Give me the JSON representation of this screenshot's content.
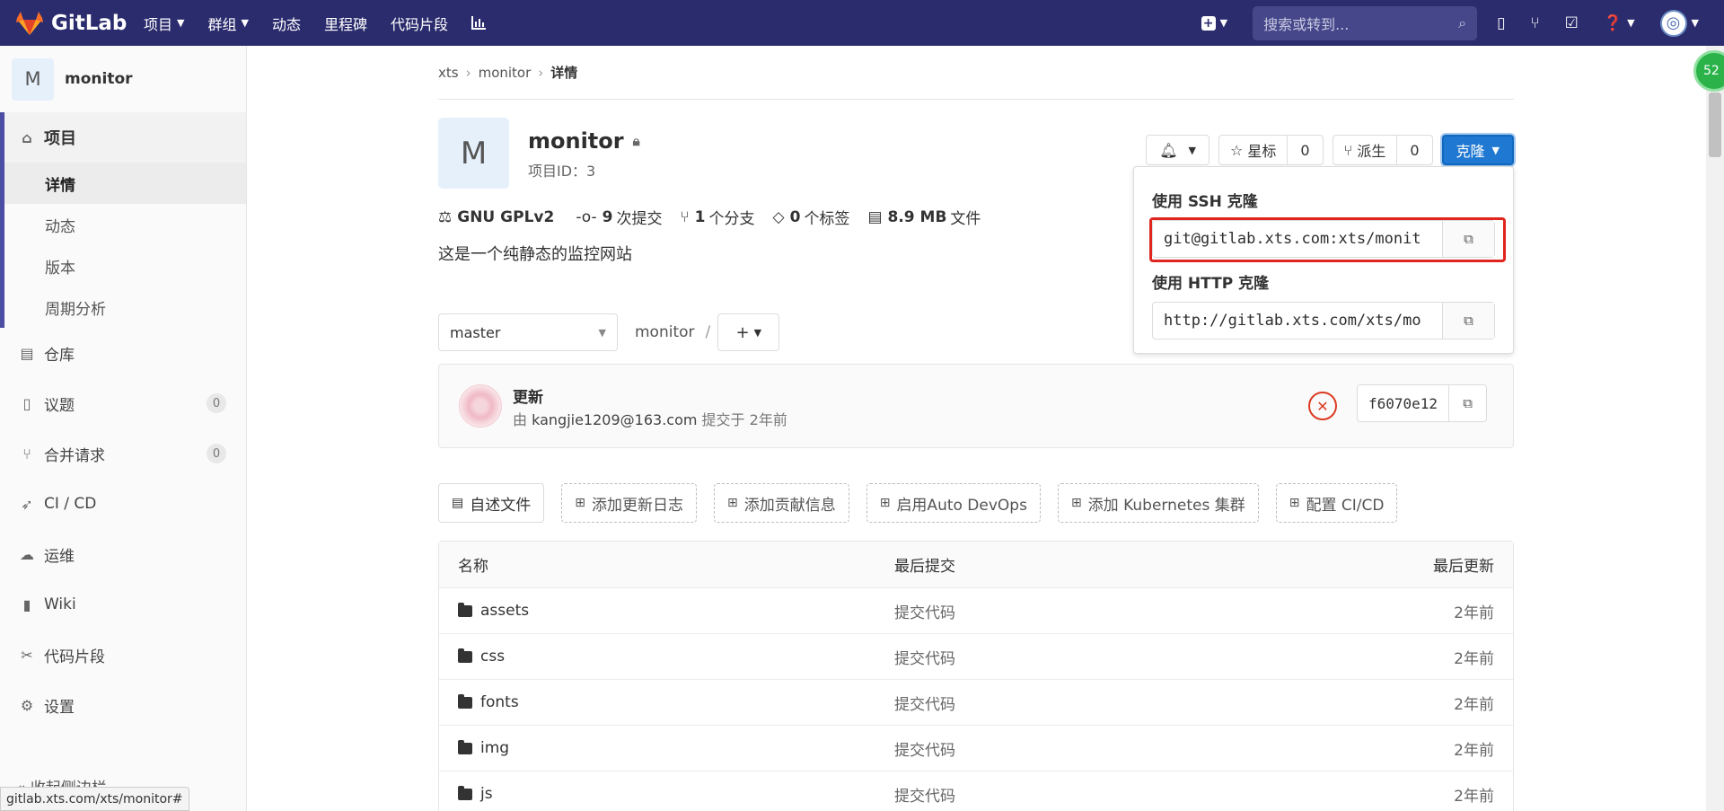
{
  "navbar": {
    "logo": "GitLab",
    "items": [
      "项目",
      "群组",
      "动态",
      "里程碑",
      "代码片段"
    ],
    "search_placeholder": "搜索或转到..."
  },
  "sidebar": {
    "project_initial": "M",
    "project_name": "monitor",
    "section": "项目",
    "subitems": [
      "详情",
      "动态",
      "版本",
      "周期分析"
    ],
    "items": [
      {
        "label": "仓库"
      },
      {
        "label": "议题",
        "badge": "0"
      },
      {
        "label": "合并请求",
        "badge": "0"
      },
      {
        "label": "CI / CD"
      },
      {
        "label": "运维"
      },
      {
        "label": "Wiki"
      },
      {
        "label": "代码片段"
      },
      {
        "label": "设置"
      }
    ],
    "collapse": "收起侧边栏"
  },
  "breadcrumb": [
    "xts",
    "monitor",
    "详情"
  ],
  "project": {
    "initial": "M",
    "name": "monitor",
    "id_label": "项目ID：3",
    "license": "GNU GPLv2",
    "commits_num": "9",
    "commits_label": "次提交",
    "branches_num": "1",
    "branches_label": "个分支",
    "tags_num": "0",
    "tags_label": "个标签",
    "size_num": "8.9 MB",
    "size_label": "文件",
    "description": "这是一个纯静态的监控网站"
  },
  "actions": {
    "star_label": "星标",
    "star_count": "0",
    "fork_label": "派生",
    "fork_count": "0",
    "clone_label": "克隆"
  },
  "clone": {
    "ssh_label": "使用 SSH 克隆",
    "ssh_url": "git@gitlab.xts.com:xts/monit",
    "http_label": "使用 HTTP 克隆",
    "http_url": "http://gitlab.xts.com/xts/mo"
  },
  "branch": {
    "selected": "master",
    "path": "monitor",
    "path_sep": "/"
  },
  "commit": {
    "title": "更新",
    "by": "由",
    "author": "kangjie1209@163.com",
    "time": "提交于 2年前",
    "sha": "f6070e12"
  },
  "shortcuts": [
    "自述文件",
    "添加更新日志",
    "添加贡献信息",
    "启用Auto DevOps",
    "添加 Kubernetes 集群",
    "配置 CI/CD"
  ],
  "files": {
    "headers": [
      "名称",
      "最后提交",
      "最后更新"
    ],
    "rows": [
      {
        "name": "assets",
        "commit": "提交代码",
        "updated": "2年前"
      },
      {
        "name": "css",
        "commit": "提交代码",
        "updated": "2年前"
      },
      {
        "name": "fonts",
        "commit": "提交代码",
        "updated": "2年前"
      },
      {
        "name": "img",
        "commit": "提交代码",
        "updated": "2年前"
      },
      {
        "name": "js",
        "commit": "提交代码",
        "updated": "2年前"
      }
    ]
  },
  "status_url": "gitlab.xts.com/xts/monitor#",
  "badge_text": "52",
  "colors": {
    "navbar": "#2b2c6d",
    "clone_button": "#1f78d1",
    "highlight": "#e0251e",
    "pipeline_failed": "#db3b21"
  }
}
